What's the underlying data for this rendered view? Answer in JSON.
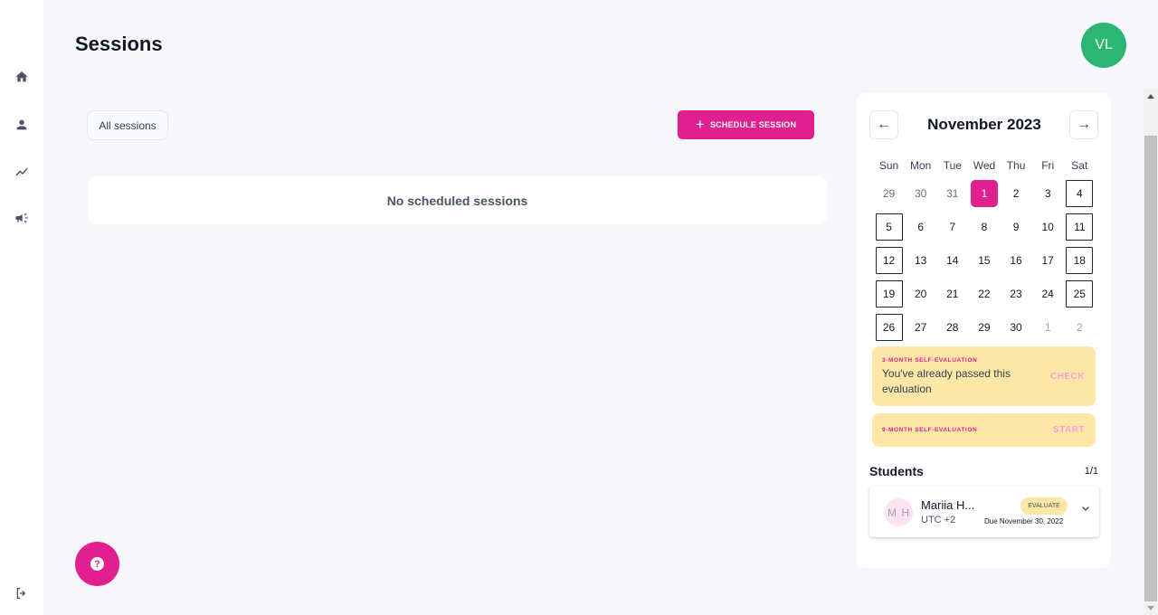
{
  "page": {
    "title": "Sessions"
  },
  "user": {
    "initials": "VL"
  },
  "nav": {
    "items": [
      {
        "name": "home-icon"
      },
      {
        "name": "person-icon"
      },
      {
        "name": "trend-icon"
      },
      {
        "name": "megaphone-icon"
      }
    ],
    "logout_icon": "logout-icon"
  },
  "filters": {
    "label": "All sessions"
  },
  "actions": {
    "schedule_plus": "+",
    "schedule_label": "SCHEDULE SESSION"
  },
  "sessions": {
    "empty_message": "No scheduled sessions"
  },
  "help": {
    "glyph": "?"
  },
  "calendar": {
    "prev_arrow": "←",
    "next_arrow": "→",
    "month_label": "November 2023",
    "weekdays": [
      "Sun",
      "Mon",
      "Tue",
      "Wed",
      "Thu",
      "Fri",
      "Sat"
    ],
    "weeks": [
      [
        "29",
        "30",
        "31",
        "1",
        "2",
        "3",
        "4"
      ],
      [
        "5",
        "6",
        "7",
        "8",
        "9",
        "10",
        "11"
      ],
      [
        "12",
        "13",
        "14",
        "15",
        "16",
        "17",
        "18"
      ],
      [
        "19",
        "20",
        "21",
        "22",
        "23",
        "24",
        "25"
      ],
      [
        "26",
        "27",
        "28",
        "29",
        "30",
        "1",
        "2"
      ]
    ],
    "selected_day": "1"
  },
  "evaluations": [
    {
      "label": "3-MONTH SELF-EVALUATION",
      "text": "You've already passed this evaluation",
      "action": "CHECK"
    },
    {
      "label": "9-MONTH SELF-EVALUATION",
      "text": "",
      "action": "START"
    }
  ],
  "students": {
    "title": "Students",
    "count": "1/1",
    "items": [
      {
        "initials": "M H",
        "name": "Mariia H...",
        "timezone": "UTC +2",
        "badge": "EVALUATE",
        "due": "Due November 30, 2022"
      }
    ]
  },
  "colors": {
    "accent": "#e0208f",
    "avatar_green": "#2bb673",
    "eval_yellow": "#fde7a7",
    "page_bg": "#f7f7fb"
  }
}
